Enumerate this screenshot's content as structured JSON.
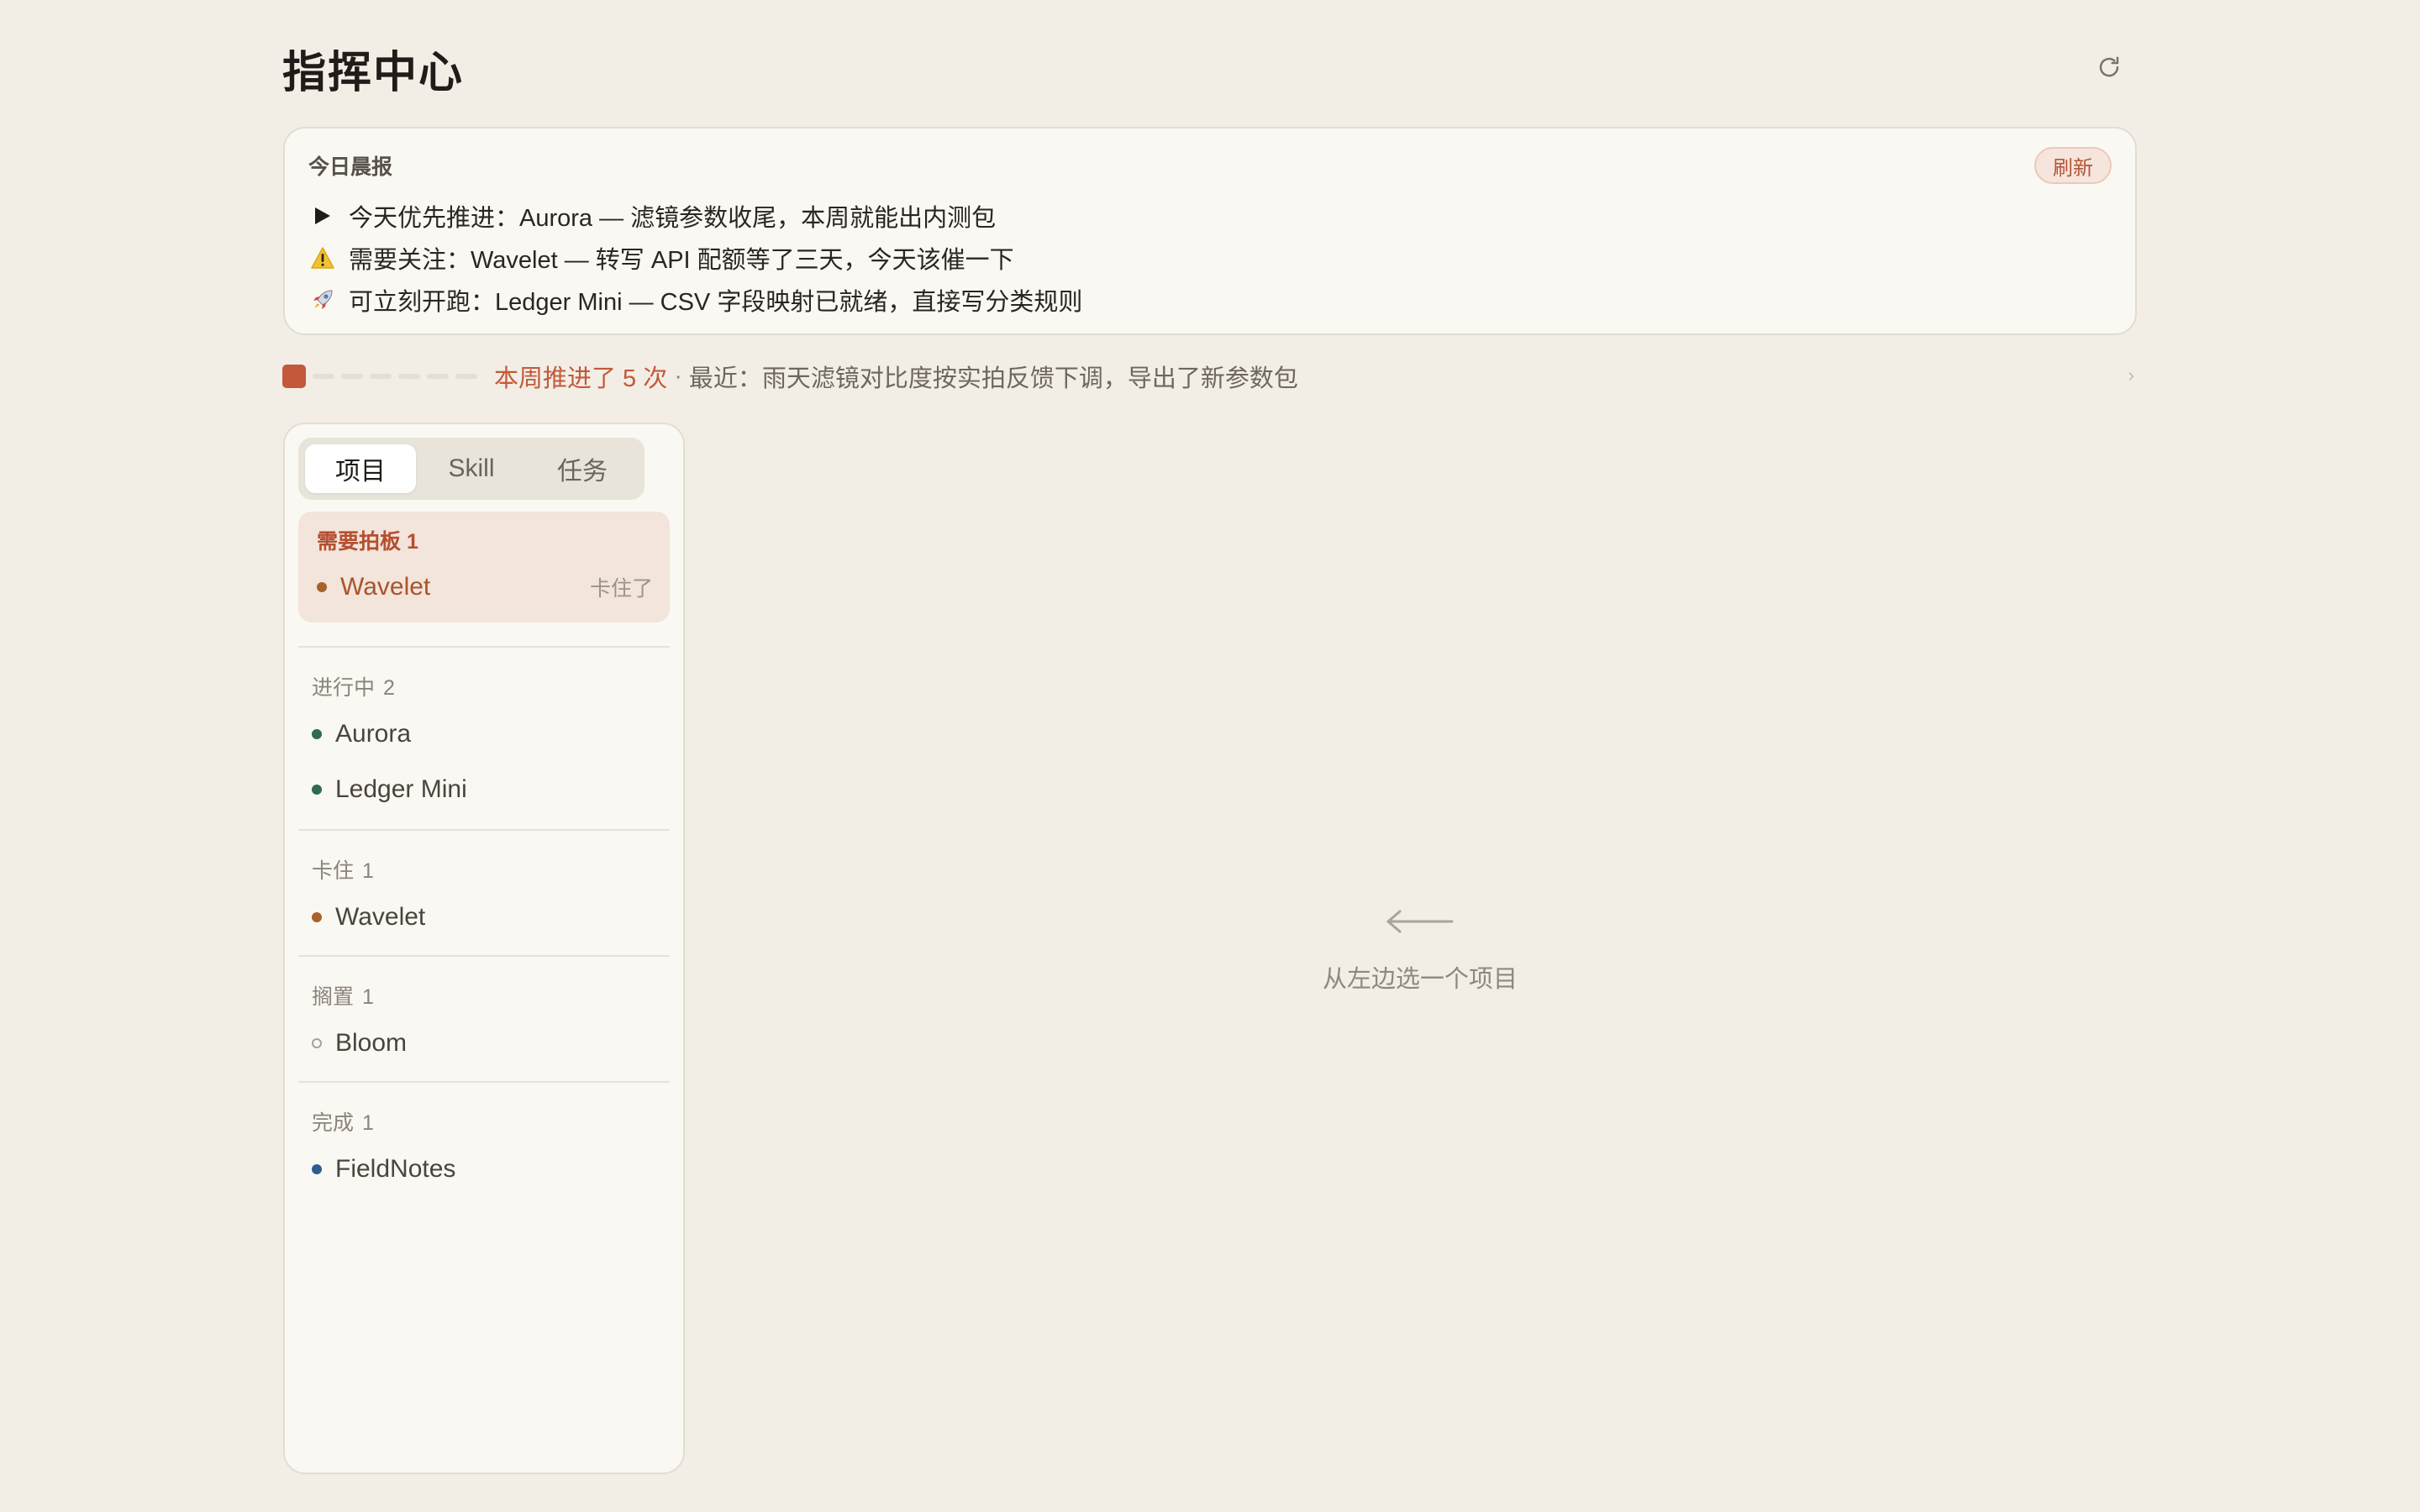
{
  "header": {
    "title": "指挥中心",
    "reload_icon": "refresh-cw-icon"
  },
  "briefing": {
    "title": "今日晨报",
    "refresh_label": "刷新",
    "lines": [
      {
        "icon": "play-triangle-icon",
        "text": "今天优先推进：Aurora — 滤镜参数收尾，本周就能出内测包"
      },
      {
        "icon": "warning-icon",
        "text": "需要关注：Wavelet — 转写 API 配额等了三天，今天该催一下"
      },
      {
        "icon": "rocket-icon",
        "text": "可立刻开跑：Ledger Mini — CSV 字段映射已就绪，直接写分类规则"
      }
    ]
  },
  "progress": {
    "active_segments": 1,
    "total_segments": 7,
    "summary": "本周推进了 5 次",
    "separator": "·",
    "recent": "最近：雨天滤镜对比度按实拍反馈下调，导出了新参数包",
    "accent_color": "#c3593a"
  },
  "sidebar": {
    "tabs": [
      {
        "label": "项目",
        "active": true
      },
      {
        "label": "Skill",
        "active": false
      },
      {
        "label": "任务",
        "active": false
      }
    ],
    "attention": {
      "title": "需要拍板",
      "count": "1",
      "item": {
        "name": "Wavelet",
        "tag": "卡住了",
        "status": "blocked"
      }
    },
    "groups": [
      {
        "title": "进行中",
        "count": "2",
        "items": [
          {
            "name": "Aurora",
            "status": "active"
          },
          {
            "name": "Ledger Mini",
            "status": "active"
          }
        ]
      },
      {
        "title": "卡住",
        "count": "1",
        "items": [
          {
            "name": "Wavelet",
            "status": "blocked"
          }
        ]
      },
      {
        "title": "搁置",
        "count": "1",
        "items": [
          {
            "name": "Bloom",
            "status": "paused"
          }
        ]
      },
      {
        "title": "完成",
        "count": "1",
        "items": [
          {
            "name": "FieldNotes",
            "status": "done"
          }
        ]
      }
    ]
  },
  "empty_state": {
    "icon": "arrow-left-icon",
    "text": "从左边选一个项目"
  },
  "colors": {
    "background": "#f2eee6",
    "accent": "#c3593a",
    "active": "#2f6a54",
    "blocked": "#a8622a",
    "done": "#2c5e93"
  }
}
